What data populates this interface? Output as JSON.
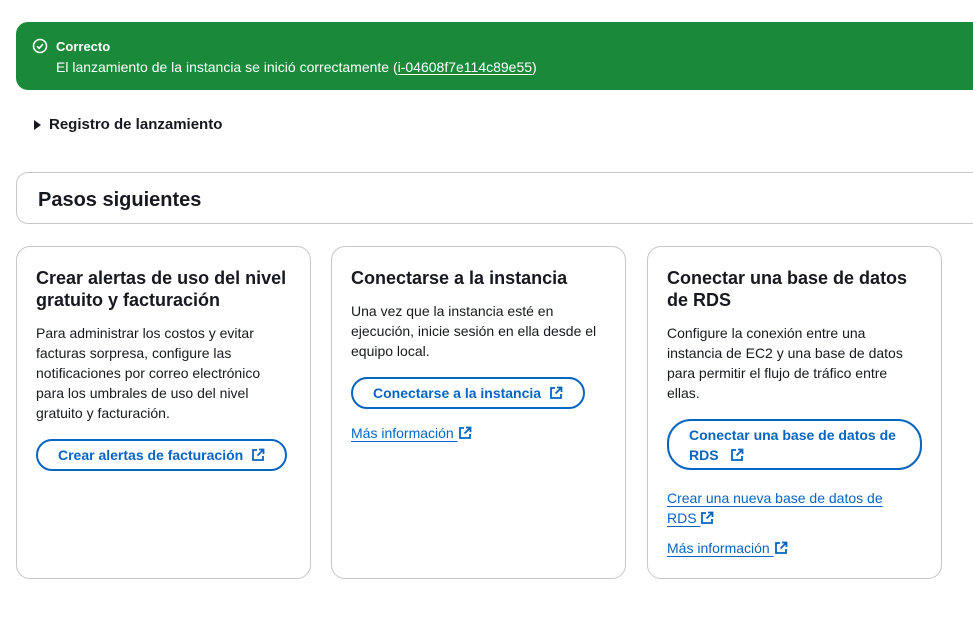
{
  "banner": {
    "title": "Correcto",
    "message": "El lanzamiento de la instancia se inició correctamente (",
    "instance_id": "i-04608f7e114c89e55",
    "message_end": ")"
  },
  "launch_log": {
    "label": "Registro de lanzamiento"
  },
  "next_steps": {
    "title": "Pasos siguientes"
  },
  "cards": [
    {
      "title": "Crear alertas de uso del nivel gratuito y facturación",
      "text": "Para administrar los costos y evitar facturas sorpresa, configure las notificaciones por correo electrónico para los umbrales de uso del nivel gratuito y facturación.",
      "button": "Crear alertas de facturación"
    },
    {
      "title": "Conectarse a la instancia",
      "text": "Una vez que la instancia esté en ejecución, inicie sesión en ella desde el equipo local.",
      "button": "Conectarse a la instancia",
      "link": "Más información"
    },
    {
      "title": "Conectar una base de datos de RDS",
      "text": "Configure la conexión entre una instancia de EC2 y una base de datos para permitir el flujo de tráfico entre ellas.",
      "button": "Conectar una base de datos de RDS",
      "link1": "Crear una nueva base de datos de RDS",
      "link2": "Más información"
    }
  ],
  "colors": {
    "success": "#1a8a3a",
    "link": "#0565c1"
  },
  "icons": [
    "check-circle-icon",
    "caret-right-icon",
    "external-link-icon"
  ]
}
